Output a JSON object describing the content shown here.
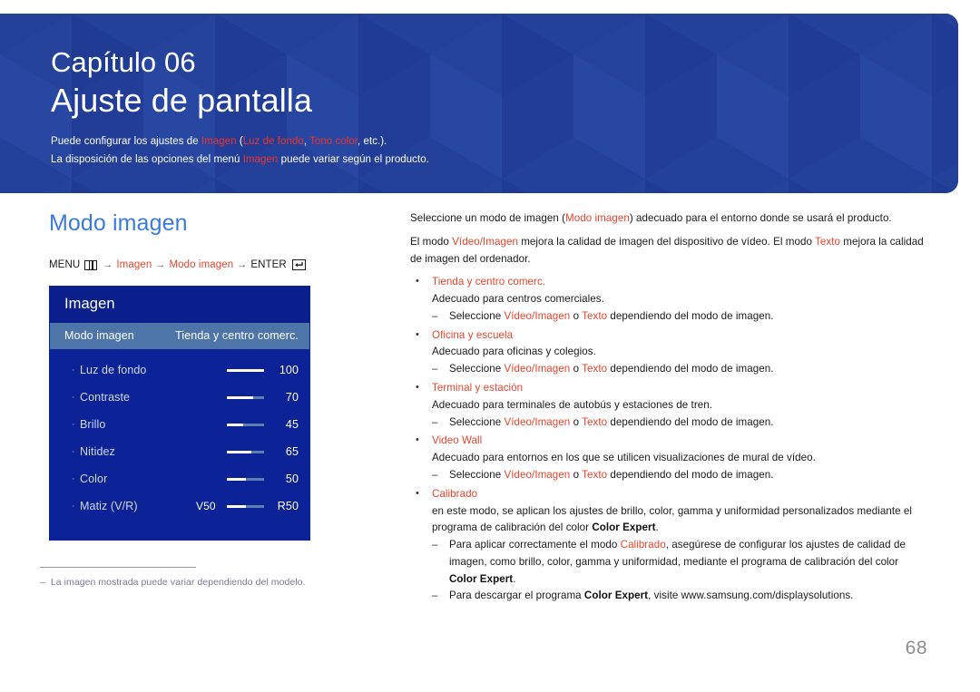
{
  "banner": {
    "chapter_label": "Capítulo 06",
    "chapter_title": "Ajuste de pantalla",
    "sub_line1_a": "Puede configurar los ajustes de ",
    "sub_line1_hl1": "Imagen",
    "sub_line1_b": " (",
    "sub_line1_hl2": "Luz de fondo",
    "sub_line1_c": ", ",
    "sub_line1_hl3": "Tono color",
    "sub_line1_d": ", etc.).",
    "sub_line2_a": "La disposición de las opciones del menú ",
    "sub_line2_hl1": "Imagen",
    "sub_line2_b": " puede variar según el producto.",
    "bg_color": "#23409a",
    "highlight_color": "#f0332b"
  },
  "section": {
    "heading": "Modo imagen",
    "heading_color": "#3b7ae0"
  },
  "menu_path": {
    "menu_label": "MENU",
    "menu_icon": "menu-bars-icon",
    "arrow": "→",
    "step1": "Imagen",
    "step2": "Modo imagen",
    "enter_label": "ENTER",
    "enter_icon": "enter-return-icon",
    "accent_color": "#e8442c"
  },
  "osd": {
    "title": "Imagen",
    "selected_row": {
      "label": "Modo imagen",
      "value": "Tienda y centro comerc."
    },
    "rows": [
      {
        "label": "Luz de fondo",
        "value": "100",
        "fill_percent": 100,
        "left_value": ""
      },
      {
        "label": "Contraste",
        "value": "70",
        "fill_percent": 70,
        "left_value": ""
      },
      {
        "label": "Brillo",
        "value": "45",
        "fill_percent": 45,
        "left_value": ""
      },
      {
        "label": "Nitidez",
        "value": "65",
        "fill_percent": 65,
        "left_value": ""
      },
      {
        "label": "Color",
        "value": "50",
        "fill_percent": 50,
        "left_value": ""
      },
      {
        "label": "Matiz (V/R)",
        "value": "R50",
        "fill_percent": 50,
        "left_value": "V50"
      }
    ],
    "panel_color": "#0b2396",
    "title_color": "#0a1f8c",
    "selected_color": "#4e75a8"
  },
  "footnote": {
    "dash": "–",
    "text": "La imagen mostrada puede variar dependiendo del modelo."
  },
  "content": {
    "para1_a": "Seleccione un modo de imagen (",
    "para1_hl": "Modo imagen",
    "para1_b": ") adecuado para el entorno donde se usará el producto.",
    "para2_a": "El modo ",
    "para2_hl1": "Vídeo/Imagen",
    "para2_b": " mejora la calidad de imagen del dispositivo de vídeo. El modo ",
    "para2_hl2": "Texto",
    "para2_c": " mejora la calidad de imagen del ordenador.",
    "bullets": [
      {
        "title": "Tienda y centro comerc.",
        "description": "Adecuado para centros comerciales.",
        "notes": [
          {
            "a": "Seleccione ",
            "hl1": "Vídeo/Imagen",
            "b": " o ",
            "hl2": "Texto",
            "c": " dependiendo del modo de imagen."
          }
        ]
      },
      {
        "title": "Oficina y escuela",
        "description": "Adecuado para oficinas y colegios.",
        "notes": [
          {
            "a": "Seleccione ",
            "hl1": "Vídeo/Imagen",
            "b": " o ",
            "hl2": "Texto",
            "c": " dependiendo del modo de imagen."
          }
        ]
      },
      {
        "title": "Terminal y estación",
        "description": "Adecuado para terminales de autobús y estaciones de tren.",
        "notes": [
          {
            "a": "Seleccione ",
            "hl1": "Vídeo/Imagen",
            "b": " o ",
            "hl2": "Texto",
            "c": " dependiendo del modo de imagen."
          }
        ]
      },
      {
        "title": "Video Wall",
        "description": "Adecuado para entornos en los que se utilicen visualizaciones de mural de vídeo.",
        "notes": [
          {
            "a": "Seleccione ",
            "hl1": "Vídeo/Imagen",
            "b": " o ",
            "hl2": "Texto",
            "c": " dependiendo del modo de imagen."
          }
        ]
      }
    ],
    "calibrado": {
      "title": "Calibrado",
      "desc_a": "en este modo, se aplican los ajustes de brillo, color, gamma y uniformidad personalizados mediante el programa de calibración del color ",
      "desc_bold": "Color Expert",
      "desc_b": ".",
      "note1_a": "Para aplicar correctamente el modo ",
      "note1_hl": "Calibrado",
      "note1_b": ", asegúrese de configurar los ajustes de calidad de imagen, como brillo, color, gamma y uniformidad, mediante el programa de calibración del color ",
      "note1_bold": "Color Expert",
      "note1_c": ".",
      "note2_a": "Para descargar el programa ",
      "note2_bold": "Color Expert",
      "note2_b": ", visite www.samsung.com/displaysolutions."
    },
    "bullet_mark": "•",
    "dash_mark": "–",
    "accent_color": "#e8442c"
  },
  "page_number": "68"
}
